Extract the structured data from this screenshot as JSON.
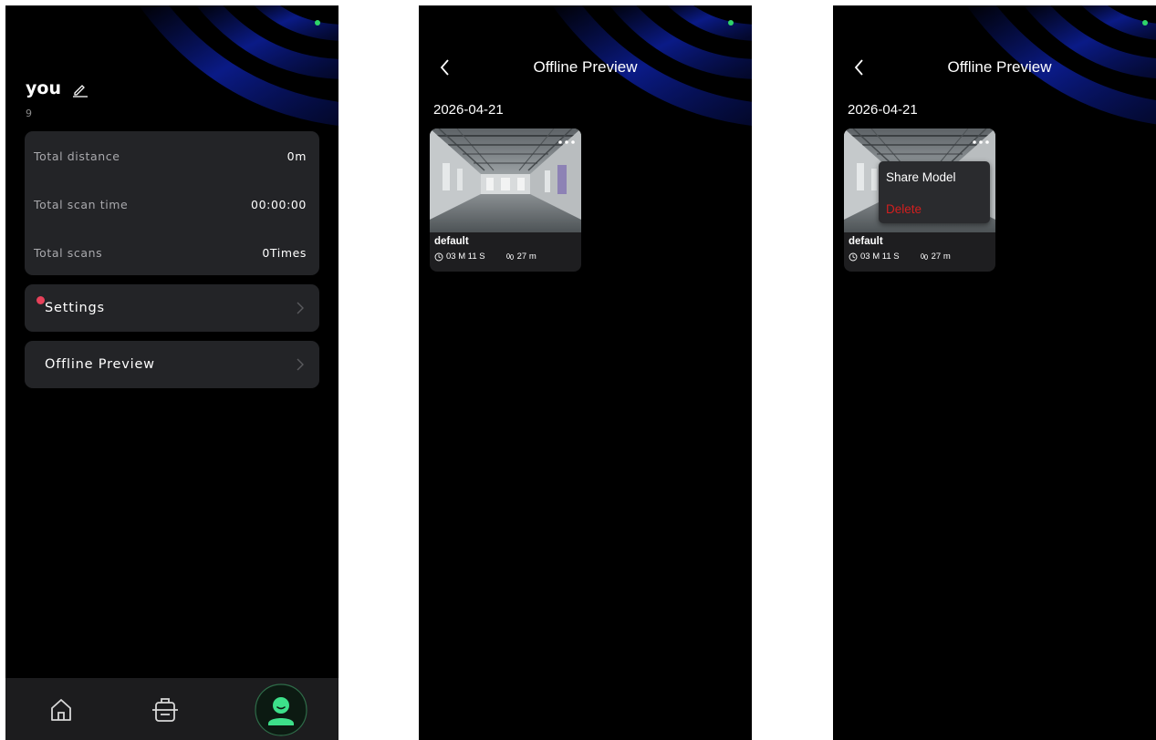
{
  "profile_screen": {
    "user": {
      "name": "you",
      "id": "9"
    },
    "stats": [
      {
        "label": "Total distance",
        "value": "0m"
      },
      {
        "label": "Total scan time",
        "value": "00:00:00"
      },
      {
        "label": "Total scans",
        "value": "0Times"
      }
    ],
    "menu": {
      "settings_label": "Settings",
      "offline_preview_label": "Offline Preview"
    },
    "tab_bar": {
      "tabs": [
        {
          "icon": "home-icon",
          "active": false
        },
        {
          "icon": "scanner-icon",
          "active": false
        },
        {
          "icon": "profile-icon",
          "active": true
        }
      ]
    }
  },
  "offline_preview_screen": {
    "title": "Offline Preview",
    "date": "2026-04-21",
    "model": {
      "name": "default",
      "duration": "03 M 11 S",
      "distance": "27 m"
    }
  },
  "offline_preview_menu_screen": {
    "title": "Offline Preview",
    "date": "2026-04-21",
    "model": {
      "name": "default",
      "duration": "03 M 11 S",
      "distance": "27 m"
    },
    "popup_menu": {
      "share_label": "Share Model",
      "delete_label": "Delete"
    }
  },
  "colors": {
    "background": "#000000",
    "card": "#232427",
    "status_dot": "#2fd46a",
    "badge": "#e6415a",
    "active_tab": "#3de08a",
    "delete": "#d21f1f"
  }
}
